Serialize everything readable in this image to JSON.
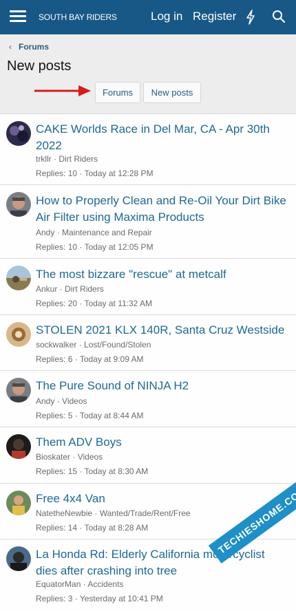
{
  "header": {
    "site_title": "SOUTH BAY RIDERS",
    "login": "Log in",
    "register": "Register",
    "icons": {
      "menu": "hamburger-icon",
      "whats_new": "bolt-icon",
      "search": "search-icon"
    },
    "brand_color": "#185886"
  },
  "breadcrumb": {
    "chevron": "‹",
    "label": "Forums"
  },
  "page_title": "New posts",
  "filter_buttons": {
    "forums": "Forums",
    "new_posts": "New posts"
  },
  "annotation_arrow_color": "#d81b1b",
  "link_color": "#1f6893",
  "threads": [
    {
      "title": "CAKE Worlds Race in Del Mar, CA - Apr 30th 2022",
      "author": "trkllr",
      "forum": "Dirt Riders",
      "replies": "Replies: 10",
      "time": "Today at 12:28 PM"
    },
    {
      "title": "How to Properly Clean and Re-Oil Your Dirt Bike Air Filter using Maxima Products",
      "author": "Andy",
      "forum": "Maintenance and Repair",
      "replies": "Replies: 10",
      "time": "Today at 12:05 PM"
    },
    {
      "title": "The most bizzare \"rescue\" at metcalf",
      "author": "Ankur",
      "forum": "Dirt Riders",
      "replies": "Replies: 20",
      "time": "Today at 11:32 AM"
    },
    {
      "title": "STOLEN 2021 KLX 140R, Santa Cruz Westside",
      "author": "sockwalker",
      "forum": "Lost/Found/Stolen",
      "replies": "Replies: 6",
      "time": "Today at 9:09 AM"
    },
    {
      "title": "The Pure Sound of NINJA H2",
      "author": "Andy",
      "forum": "Videos",
      "replies": "Replies: 5",
      "time": "Today at 8:44 AM"
    },
    {
      "title": "Them ADV Boys",
      "author": "Bioskater",
      "forum": "Videos",
      "replies": "Replies: 15",
      "time": "Today at 8:30 AM"
    },
    {
      "title": "Free 4x4 Van",
      "author": "NatetheNewbie",
      "forum": "Wanted/Trade/Rent/Free",
      "replies": "Replies: 14",
      "time": "Today at 8:28 AM"
    },
    {
      "title": "La Honda Rd: Elderly California motorcyclist dies after crashing into tree",
      "author": "EquatorMan",
      "forum": "Accidents",
      "replies": "Replies: 3",
      "time": "Yesterday at 10:41 PM"
    }
  ],
  "watermark": "TECHIESHOME.COM"
}
